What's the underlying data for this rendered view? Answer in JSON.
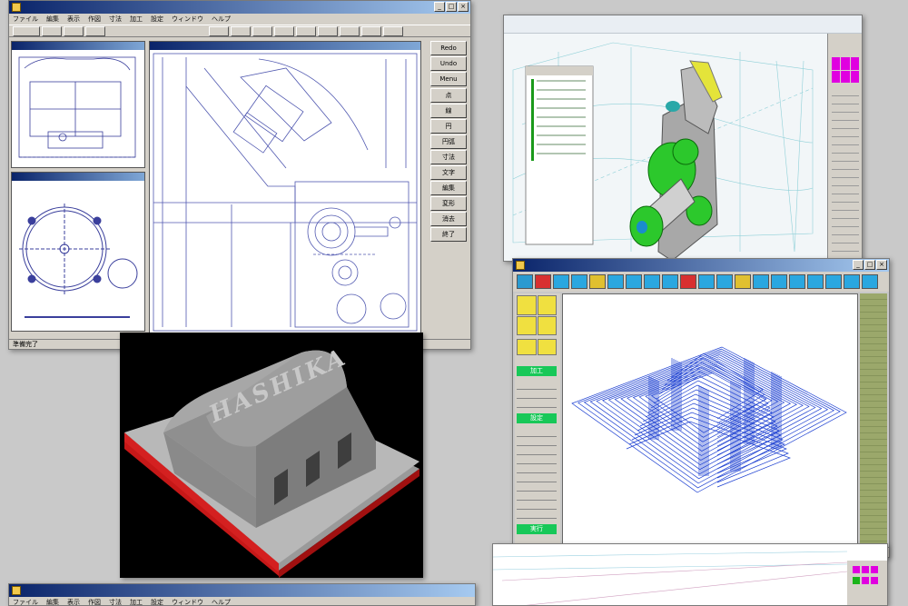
{
  "cad_window": {
    "menu": [
      "ファイル",
      "編集",
      "表示",
      "作図",
      "寸法",
      "加工",
      "設定",
      "ウィンドウ",
      "ヘルプ"
    ],
    "side_buttons": [
      "Redo",
      "Undo",
      "Menu",
      "点",
      "線",
      "円",
      "円弧",
      "寸法",
      "文字",
      "編集",
      "変形",
      "消去",
      "終了"
    ],
    "status": "準備完了"
  },
  "render_3d": {
    "engraved_text": "HASHIKA",
    "base_color": "#c61818",
    "body_color": "#9c9c9c"
  },
  "toolpath_window": {
    "side_labels": [
      "加工",
      "設定",
      "実行"
    ],
    "path_color": "#1c3fd1"
  },
  "bottom_window": {
    "menu": [
      "ファイル",
      "編集",
      "表示",
      "作図",
      "寸法",
      "加工",
      "設定",
      "ウィンドウ",
      "ヘルプ"
    ]
  }
}
